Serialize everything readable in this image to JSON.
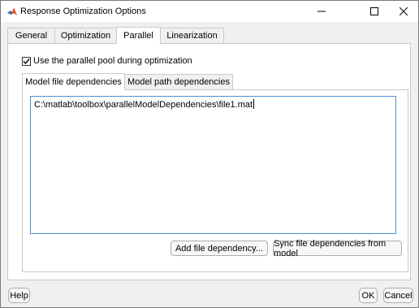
{
  "window": {
    "title": "Response Optimization Options",
    "icon": "matlab-logo-icon",
    "controls": [
      "minimize-icon",
      "maximize-icon",
      "close-icon"
    ]
  },
  "tabs": [
    {
      "label": "General"
    },
    {
      "label": "Optimization"
    },
    {
      "label": "Parallel",
      "active": true
    },
    {
      "label": "Linearization"
    }
  ],
  "parallel": {
    "use_pool_label": "Use the parallel pool during optimization",
    "use_pool_checked": true,
    "subtabs": [
      {
        "label": "Model file dependencies",
        "active": true
      },
      {
        "label": "Model path dependencies"
      }
    ],
    "dependencies_text": "C:\\matlab\\toolbox\\parallelModelDependencies\\file1.mat",
    "add_button": "Add file dependency...",
    "sync_button": "Sync file dependencies from model"
  },
  "footer": {
    "help": "Help",
    "ok": "OK",
    "cancel": "Cancel"
  },
  "colors": {
    "accent": "#4a90d9",
    "window_bg": "#f0f0f0"
  }
}
